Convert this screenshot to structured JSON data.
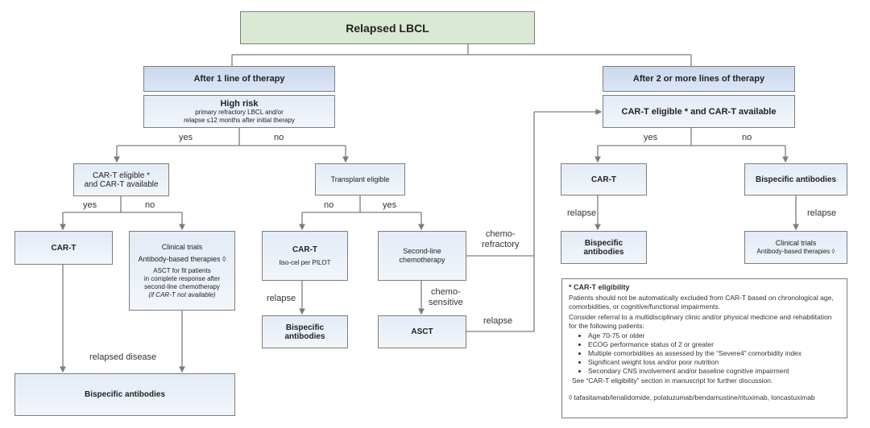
{
  "title": "Relapsed LBCL",
  "left_branch": {
    "header": "After 1 line of therapy",
    "high_risk": {
      "title": "High risk",
      "line1": "primary refractory LBCL and/or",
      "line2": "relapse ≤12 months after initial therapy"
    },
    "yes": "yes",
    "no": "no",
    "cart_eligible": {
      "line1": "CAR-T eligible *",
      "line2": "and CAR-T available"
    },
    "cart_yes": "yes",
    "cart_no": "no",
    "cart_box": "CAR-T",
    "clinical": {
      "title": "Clinical trials",
      "antibody": "Antibody-based therapies ◊",
      "asct1": "ASCT for fit patients",
      "asct2": "in complete response after",
      "asct3": "second-line chemotherapy",
      "asct4": "(if CAR-T not available)"
    },
    "relapsed_disease": "relapsed disease",
    "bispecific_bottom": "Bispecific antibodies",
    "transplant_eligible": "Transplant eligible",
    "te_no": "no",
    "te_yes": "yes",
    "cart_pilot": {
      "title": "CAR-T",
      "sub": "liso-cel per PILOT"
    },
    "relapse1": "relapse",
    "bispecific_mid": {
      "line1": "Bispecific",
      "line2": "antibodies"
    },
    "second_line": {
      "line1": "Second-line",
      "line2": "chemotherapy"
    },
    "chemo_sensitive": {
      "line1": "chemo-",
      "line2": "sensitive"
    },
    "chemo_refractory": {
      "line1": "chemo-",
      "line2": "refractory"
    },
    "asct": "ASCT",
    "relapse2": "relapse"
  },
  "right_branch": {
    "header": "After 2 or more lines of therapy",
    "cart_eligible": "CAR-T eligible * and CAR-T available",
    "yes": "yes",
    "no": "no",
    "cart_box": "CAR-T",
    "relapse_left": "relapse",
    "bispecific_left": {
      "line1": "Bispecific",
      "line2": "antibodies"
    },
    "bispecific_right": "Bispecific antibodies",
    "relapse_right": "relapse",
    "clinical": {
      "title": "Clinical trials",
      "antibody": "Antibody-based therapies ◊"
    }
  },
  "note": {
    "title": "* CAR-T eligibility",
    "p1": "Patients should not be automatically excluded from CAR-T based on chronological age, comorbidities, or cognitive/functional impairments.",
    "p2": "Consider referral to a multidisciplinary clinic and/or physical medicine and rehabilitation for the following patients:",
    "bullets": [
      "Age 70-75 or older",
      "ECOG performance status of 2 or greater",
      "Multiple comorbidities as assessed by the “Severe4” comorbidity index",
      "Significant weight loss and/or poor nutrition",
      "Secondary CNS involvement and/or baseline cognitive impairment"
    ],
    "p3": "See “CAR-T eligibility” section in manuscript for further discussion.",
    "footnote": "◊ tafasitamab/lenalidomide, polatuzumab/bendamustine/rituximab, loncastuximab"
  }
}
